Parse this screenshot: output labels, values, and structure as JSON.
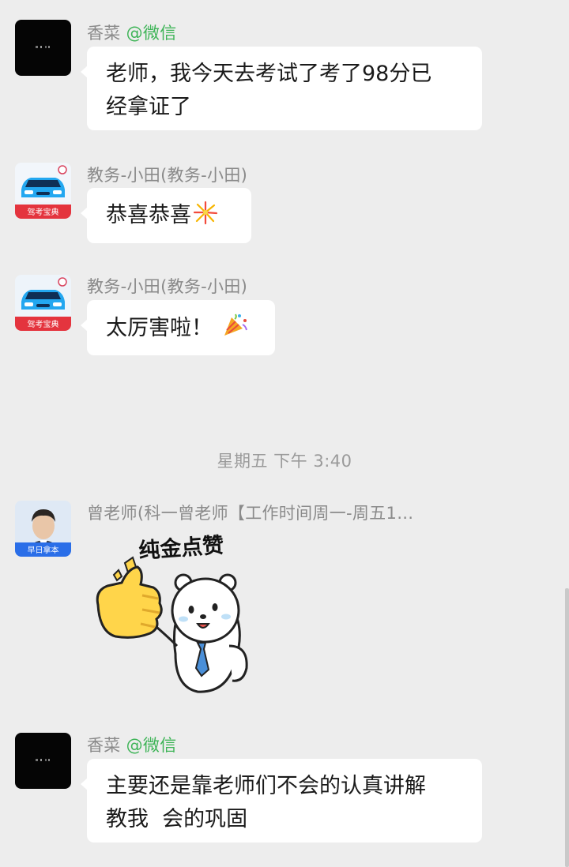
{
  "messages": [
    {
      "sender_name": "香菜",
      "sender_mention": "@微信",
      "text": "老师，我今天去考试了考了98分已经拿证了",
      "line1": "老师，我今天去考试了考了98分已",
      "line2": "经拿证了"
    },
    {
      "sender_name": "教务-小田(教务-小田)",
      "text": "恭喜恭喜",
      "emoji": "fireworks-emoji",
      "avatar_label": "驾考宝典"
    },
    {
      "sender_name": "教务-小田(教务-小田)",
      "text": "太厉害啦！",
      "emoji": "party-popper-emoji",
      "avatar_label": "驾考宝典"
    },
    {
      "sender_name": "曾老师(科一曾老师【工作时间周一-周五1…",
      "sticker_text": "纯金点赞",
      "avatar_label": "早日拿本"
    },
    {
      "sender_name": "香菜",
      "sender_mention": "@微信",
      "line1": "主要还是靠老师们不会的认真讲解",
      "line2": "教我  会的巩固"
    }
  ],
  "timestamp": "星期五  下午 3:40",
  "colors": {
    "background": "#ededed",
    "bubble": "#ffffff",
    "mention": "#3eb457",
    "secondary_text": "#8a8a8a"
  }
}
